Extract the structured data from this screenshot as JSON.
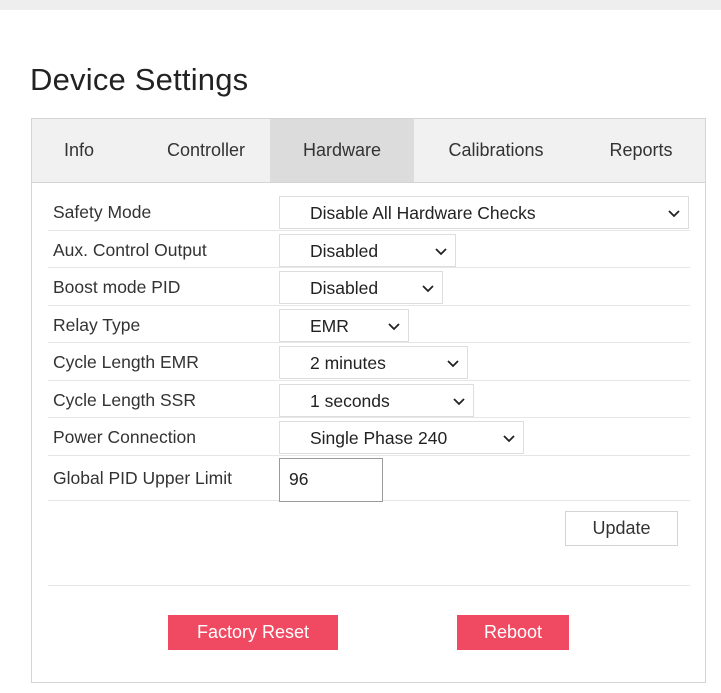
{
  "page": {
    "title": "Device Settings"
  },
  "tabs": [
    {
      "label": "Info",
      "active": false
    },
    {
      "label": "Controller",
      "active": false
    },
    {
      "label": "Hardware",
      "active": true
    },
    {
      "label": "Calibrations",
      "active": false
    },
    {
      "label": "Reports",
      "active": false
    }
  ],
  "settings": [
    {
      "label": "Safety Mode",
      "value": "Disable All Hardware Checks",
      "kind": "select"
    },
    {
      "label": "Aux. Control Output",
      "value": "Disabled",
      "kind": "select"
    },
    {
      "label": "Boost mode PID",
      "value": "Disabled",
      "kind": "select"
    },
    {
      "label": "Relay Type",
      "value": "EMR",
      "kind": "select"
    },
    {
      "label": "Cycle Length EMR",
      "value": "2 minutes",
      "kind": "select"
    },
    {
      "label": "Cycle Length SSR",
      "value": "1 seconds",
      "kind": "select"
    },
    {
      "label": "Power Connection",
      "value": "Single Phase 240",
      "kind": "select"
    },
    {
      "label": "Global PID Upper Limit",
      "value": "96",
      "kind": "input"
    }
  ],
  "actions": {
    "update_label": "Update",
    "factory_reset_label": "Factory Reset",
    "reboot_label": "Reboot"
  },
  "icons": {
    "select_chevron": "chevron-down-icon"
  },
  "colors": {
    "danger": "#f04a63",
    "active_tab": "#dcdcdc",
    "tab_bar": "#f1f1f1",
    "border": "#d4d4d4"
  }
}
